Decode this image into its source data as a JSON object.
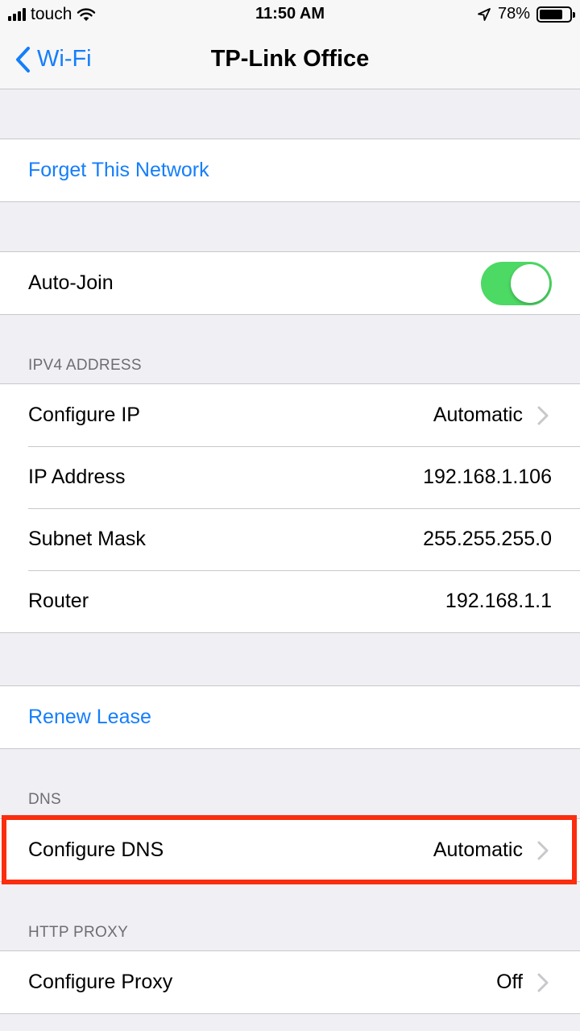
{
  "status_bar": {
    "carrier": "touch",
    "time": "11:50 AM",
    "battery_percent": "78%",
    "battery_level": 0.78,
    "icons": [
      "signal-bars-icon",
      "wifi-icon",
      "location-arrow-icon",
      "battery-icon"
    ]
  },
  "nav": {
    "back_label": "Wi-Fi",
    "title": "TP-Link Office"
  },
  "forget_network": {
    "label": "Forget This Network"
  },
  "auto_join": {
    "label": "Auto-Join",
    "enabled": true
  },
  "ipv4": {
    "header": "IPV4 ADDRESS",
    "configure_ip": {
      "label": "Configure IP",
      "value": "Automatic"
    },
    "ip_address": {
      "label": "IP Address",
      "value": "192.168.1.106"
    },
    "subnet_mask": {
      "label": "Subnet Mask",
      "value": "255.255.255.0"
    },
    "router": {
      "label": "Router",
      "value": "192.168.1.1"
    }
  },
  "renew_lease": {
    "label": "Renew Lease"
  },
  "dns": {
    "header": "DNS",
    "configure_dns": {
      "label": "Configure DNS",
      "value": "Automatic"
    }
  },
  "http_proxy": {
    "header": "HTTP PROXY",
    "configure_proxy": {
      "label": "Configure Proxy",
      "value": "Off"
    }
  },
  "colors": {
    "accent": "#157efb",
    "toggle_on": "#4cd964",
    "highlight": "#fa2d0f",
    "background": "#efeff4"
  }
}
